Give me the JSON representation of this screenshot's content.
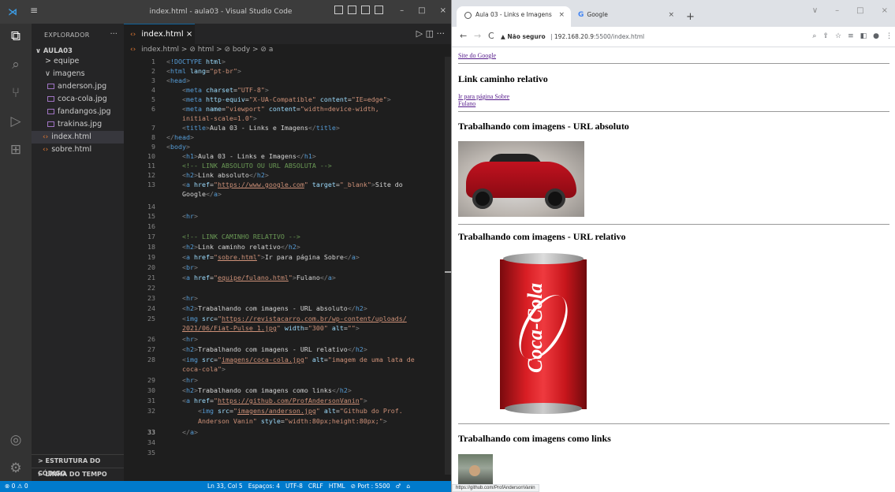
{
  "vscode": {
    "window_title": "index.html - aula03 - Visual Studio Code",
    "explorer_title": "EXPLORADOR",
    "explorer_more": "···",
    "root_folder": "∨ AULA03",
    "tree": [
      {
        "label": "> equipe",
        "type": "folder"
      },
      {
        "label": "∨ imagens",
        "type": "folder"
      },
      {
        "label": "anderson.jpg",
        "type": "image"
      },
      {
        "label": "coca-cola.jpg",
        "type": "image"
      },
      {
        "label": "fandangos.jpg",
        "type": "image"
      },
      {
        "label": "trakinas.jpg",
        "type": "image"
      },
      {
        "label": "index.html",
        "type": "html"
      },
      {
        "label": "sobre.html",
        "type": "html"
      }
    ],
    "outline_label": "> ESTRUTURA DO CÓDIGO",
    "timeline_label": "> LINHA DO TEMPO",
    "tab_label": "index.html",
    "tab_close": "×",
    "tab_actions": "▷ ◫ ···",
    "breadcrumb": "index.html > ⊘ html > ⊘ body > ⊘ a",
    "status_left": "⊗ 0 ⚠ 0",
    "status_items": [
      "Ln 33, Col 5",
      "Espaços: 4",
      "UTF-8",
      "CRLF",
      "HTML",
      "⊘ Port : 5500"
    ]
  },
  "chrome": {
    "tab1_title": "Aula 03 - Links e Imagens",
    "tab2_title": "Google",
    "tab_close": "×",
    "new_tab": "+",
    "nav_back": "←",
    "nav_forward": "→",
    "nav_reload": "C",
    "security_label": "▲ Não seguro",
    "url_host": "192.168.20.9",
    "url_rest": ":5500/index.html",
    "status_url": "https://github.com/ProfAndersonVanin"
  },
  "page": {
    "link_google": "Site do Google",
    "h_relative": "Link caminho relativo",
    "link_sobre": "Ir para página Sobre",
    "link_fulano": "Fulano",
    "h_img_abs": "Trabalhando com imagens - URL absoluto",
    "h_img_rel": "Trabalhando com imagens - URL relativo",
    "h_img_links": "Trabalhando com imagens como links",
    "can_label": "Coca-Cola"
  },
  "code": {
    "current_line": 33
  }
}
